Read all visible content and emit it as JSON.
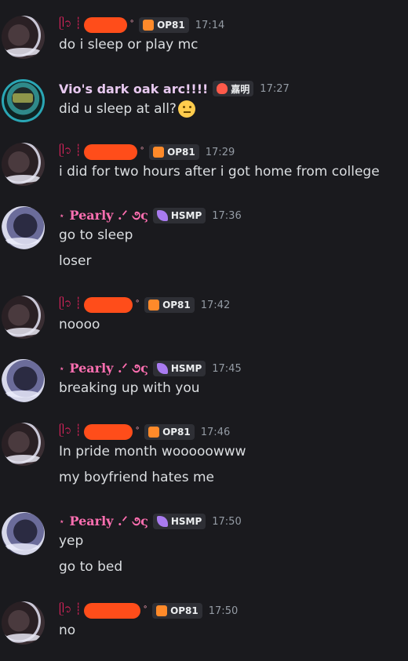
{
  "colors": {
    "background": "#1a1a1e",
    "redaction": "#ff4d1a",
    "pearly_name": "#ff6fb1",
    "vio_name": "#e8c9f0",
    "timestamp": "#949ba4"
  },
  "users": {
    "redacted_user": {
      "prefix": "ᥫ᭡ ┊",
      "suffix": "˚",
      "tag": "OP81",
      "tag_icon": "fox-icon"
    },
    "vio": {
      "name": "Vio's dark oak arc!!!!",
      "tag": "嘉明",
      "tag_icon": "fire-icon"
    },
    "pearly": {
      "prefix": "⋆",
      "name": "Pearly .ᐟ ૭ς",
      "tag": "HSMP",
      "tag_icon": "leaf-icon"
    }
  },
  "messages": [
    {
      "time": "17:14",
      "lines": [
        "do i sleep or play mc"
      ]
    },
    {
      "time": "17:27",
      "lines": [
        "did u sleep at all?"
      ]
    },
    {
      "time": "17:29",
      "lines": [
        "i did for two hours after i got home from college"
      ]
    },
    {
      "time": "17:36",
      "lines": [
        "go to sleep",
        "loser"
      ]
    },
    {
      "time": "17:42",
      "lines": [
        "noooo"
      ]
    },
    {
      "time": "17:45",
      "lines": [
        "breaking up with you"
      ]
    },
    {
      "time": "17:46",
      "lines": [
        "In pride month wooooowww",
        "my boyfriend hates me"
      ]
    },
    {
      "time": "17:50",
      "lines": [
        "yep",
        "go to bed"
      ]
    },
    {
      "time": "17:50",
      "lines": [
        "no"
      ]
    }
  ]
}
